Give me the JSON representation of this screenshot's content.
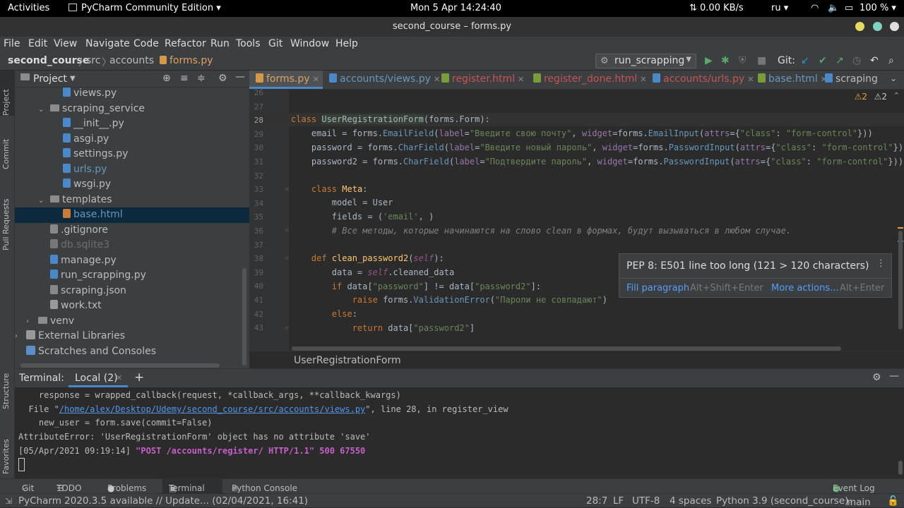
{
  "topbar": {
    "activities": "Activities",
    "app": "PyCharm Community Edition ▾",
    "clock": "Mon 5 Apr  14:24:40",
    "net": "⇅ 0.00 KB/s",
    "lang": "ru ▾",
    "battery": "100 % ▾"
  },
  "window": {
    "title": "second_course – forms.py"
  },
  "menu": [
    "File",
    "Edit",
    "View",
    "Navigate",
    "Code",
    "Refactor",
    "Run",
    "Tools",
    "Git",
    "Window",
    "Help"
  ],
  "nav": {
    "crumbs": [
      "second_course",
      "src",
      "accounts",
      "forms.py"
    ],
    "run_config": "run_scrapping",
    "git_label": "Git:"
  },
  "leftstrip": [
    "Project",
    "Commit",
    "Pull Requests",
    "Structure",
    "Favorites"
  ],
  "project": {
    "title": "Project",
    "items": [
      {
        "label": "views.py",
        "kind": "py"
      },
      {
        "label": "scraping_service",
        "kind": "folder"
      },
      {
        "label": "__init__.py",
        "kind": "py"
      },
      {
        "label": "asgi.py",
        "kind": "py"
      },
      {
        "label": "settings.py",
        "kind": "py"
      },
      {
        "label": "urls.py",
        "kind": "py"
      },
      {
        "label": "wsgi.py",
        "kind": "py"
      },
      {
        "label": "templates",
        "kind": "folder"
      },
      {
        "label": "base.html",
        "kind": "html"
      },
      {
        "label": ".gitignore",
        "kind": "file"
      },
      {
        "label": "db.sqlite3",
        "kind": "file"
      },
      {
        "label": "manage.py",
        "kind": "py"
      },
      {
        "label": "run_scrapping.py",
        "kind": "py"
      },
      {
        "label": "scraping.json",
        "kind": "file"
      },
      {
        "label": "work.txt",
        "kind": "file"
      },
      {
        "label": "venv",
        "kind": "folder"
      },
      {
        "label": "External Libraries",
        "kind": "lib"
      },
      {
        "label": "Scratches and Consoles",
        "kind": "scratch"
      }
    ]
  },
  "tabs": [
    "forms.py",
    "accounts/views.py",
    "register.html",
    "register_done.html",
    "accounts/urls.py",
    "base.html",
    "scraping"
  ],
  "inspection": {
    "warn1": "2",
    "warn2": "2"
  },
  "line_numbers": [
    "26",
    "27",
    "28",
    "29",
    "30",
    "31",
    "32",
    "33",
    "34",
    "35",
    "36",
    "37",
    "38",
    "39",
    "40",
    "41",
    "42",
    "43"
  ],
  "breadcrumb": "UserRegistrationForm",
  "popup": {
    "message": "PEP 8: E501 line too long (121 > 120 characters)",
    "action1": "Fill paragraph",
    "shortcut1": "Alt+Shift+Enter",
    "action2": "More actions...",
    "shortcut2": "Alt+Enter"
  },
  "terminal": {
    "label": "Terminal:",
    "tab": "Local (2)",
    "lines": [
      "    response = wrapped_callback(request, *callback_args, **callback_kwargs)",
      "  File \"",
      "    new_user = form.save(commit=False)",
      "AttributeError: 'UserRegistrationForm' object has no attribute 'save'",
      "[05/Apr/2021 09:19:14] "
    ],
    "file_link": "/home/alex/Desktop/Udemy/second_course/src/accounts/views.py",
    "file_rest": "\", line 28, in register_view",
    "request": "\"POST /accounts/register/ HTTP/1.1\" 500 67550"
  },
  "toolwindows": [
    "Git",
    "TODO",
    "Problems",
    "Terminal",
    "Python Console"
  ],
  "event_log": "Event Log",
  "status": {
    "message": "PyCharm 2020.3.5 available // Update... (02/04/2021, 16:41)",
    "position": "28:7",
    "line_sep": "LF",
    "encoding": "UTF-8",
    "indent": "4 spaces",
    "interpreter": "Python 3.9 (second_course)",
    "branch": "main"
  }
}
